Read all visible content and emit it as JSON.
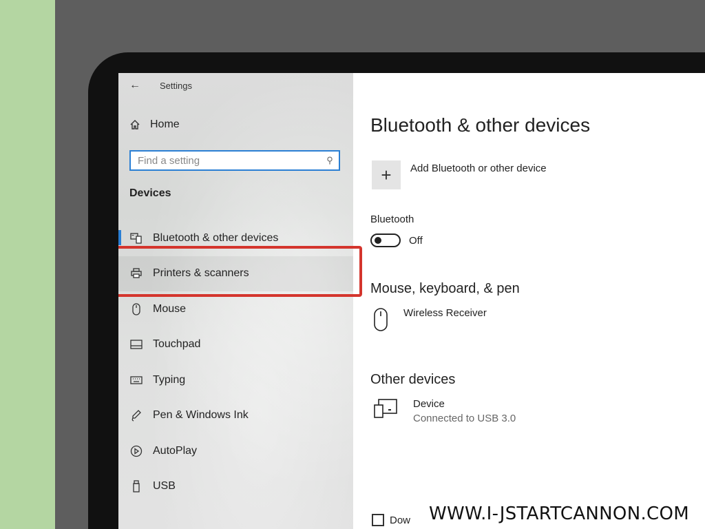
{
  "window": {
    "title": "Settings"
  },
  "sidebar": {
    "home_label": "Home",
    "search_placeholder": "Find a setting",
    "section_title": "Devices",
    "items": [
      {
        "label": "Bluetooth & other devices",
        "icon": "bluetooth-devices-icon",
        "active": true
      },
      {
        "label": "Printers & scanners",
        "icon": "printer-icon",
        "highlighted": true
      },
      {
        "label": "Mouse",
        "icon": "mouse-icon"
      },
      {
        "label": "Touchpad",
        "icon": "touchpad-icon"
      },
      {
        "label": "Typing",
        "icon": "keyboard-icon"
      },
      {
        "label": "Pen & Windows Ink",
        "icon": "pen-icon"
      },
      {
        "label": "AutoPlay",
        "icon": "autoplay-icon"
      },
      {
        "label": "USB",
        "icon": "usb-icon"
      }
    ]
  },
  "main": {
    "title": "Bluetooth & other devices",
    "add_device_label": "Add Bluetooth or other device",
    "bluetooth": {
      "label": "Bluetooth",
      "state": "Off"
    },
    "mouse_section": {
      "title": "Mouse, keyboard, & pen",
      "devices": [
        {
          "name": "Wireless Receiver"
        }
      ]
    },
    "other_section": {
      "title": "Other devices",
      "devices": [
        {
          "name": "Device",
          "status": "Connected to USB 3.0"
        }
      ]
    },
    "checkbox_label": "Dow"
  },
  "watermark": "WWW.I-JSTARTCANNON.COM",
  "colors": {
    "accent": "#2a7fd4",
    "highlight_box": "#d4352d",
    "bezel": "#5e5e5e",
    "background": "#b4d6a2"
  }
}
